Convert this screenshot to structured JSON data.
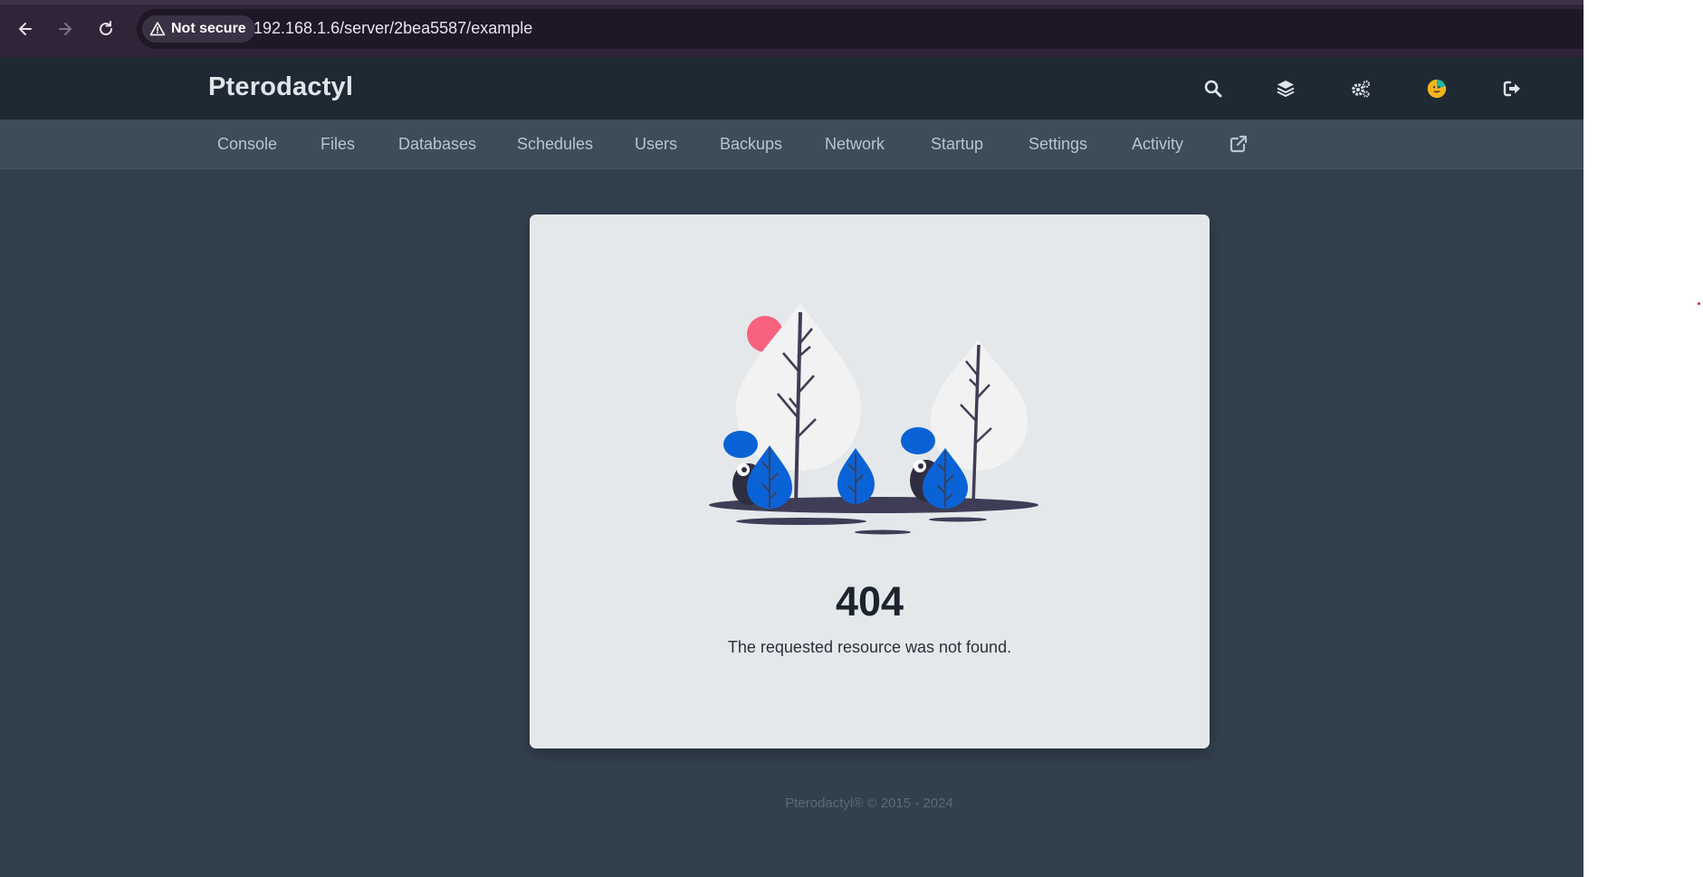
{
  "browser": {
    "security_chip": "Not secure",
    "url": "192.168.1.6/server/2bea5587/example"
  },
  "header": {
    "brand": "Pterodactyl",
    "icons": [
      "search-icon",
      "layers-icon",
      "settings-icon",
      "avatar",
      "logout-icon"
    ]
  },
  "subnav": {
    "items": [
      {
        "label": "Console"
      },
      {
        "label": "Files"
      },
      {
        "label": "Databases"
      },
      {
        "label": "Schedules"
      },
      {
        "label": "Users"
      },
      {
        "label": "Backups"
      },
      {
        "label": "Network"
      },
      {
        "label": "Startup"
      },
      {
        "label": "Settings"
      },
      {
        "label": "Activity"
      }
    ],
    "external_icon": "external-link-icon"
  },
  "error": {
    "code": "404",
    "message": "The requested resource was not found."
  },
  "footer": {
    "text": "Pterodactyl® © 2015 - 2024"
  },
  "colors": {
    "accent_blue": "#0a63d6",
    "sun_pink": "#f9627e",
    "panel_bg": "#323f4d"
  }
}
